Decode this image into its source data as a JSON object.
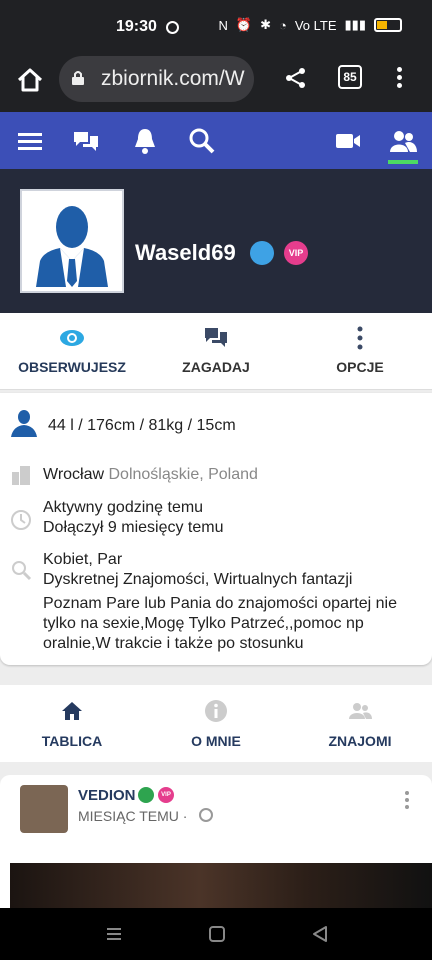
{
  "status": {
    "time": "19:30",
    "network": "Vo LTE"
  },
  "browser": {
    "url": "zbiornik.com/W",
    "tabs_count": "85"
  },
  "profile": {
    "username": "Waseld69",
    "vip_badge": "VIP"
  },
  "actions": {
    "observe": "OBSERWUJESZ",
    "talk": "ZAGADAJ",
    "options": "OPCJE"
  },
  "details": {
    "stats": "44 l / 176cm / 81kg / 15cm",
    "city": "Wrocław",
    "region": "Dolnośląskie, Poland",
    "activity": "Aktywny godzinę temu",
    "joined": "Dołączył 9 miesięcy temu",
    "looking_for": "Kobiet, Par",
    "purpose": "Dyskretnej Znajomości, Wirtualnych fantazji",
    "description": "Poznam Pare lub Pania do znajomości opartej nie tylko na sexie,Mogę Tylko Patrzeć,,pomoc np oralnie,W trakcie i także po stosunku"
  },
  "tabs": {
    "wall": "TABLICA",
    "about": "O MNIE",
    "friends": "ZNAJOMI"
  },
  "post": {
    "author": "VEDION",
    "vip_badge": "VIP",
    "time": "MIESIĄC TEMU ·"
  },
  "colors": {
    "site_nav": "#3c4fb7",
    "profile_header": "#252a3a",
    "active_tab": "#4cd964",
    "badge_couple": "#3ea2e5",
    "badge_vip": "#e53d8d"
  }
}
